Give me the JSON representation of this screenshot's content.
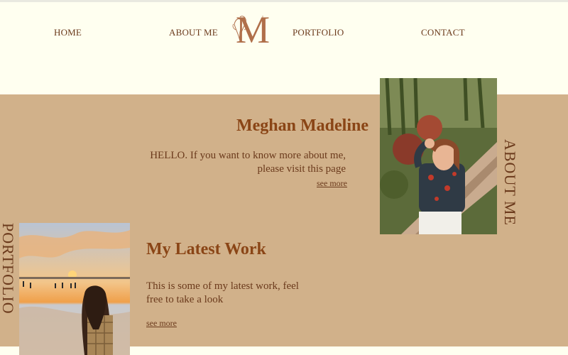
{
  "nav": {
    "home": "HOME",
    "about": "ABOUT ME",
    "portfolio": "PORTFOLIO",
    "contact": "CONTACT"
  },
  "logo": {
    "letter": "M"
  },
  "intro": {
    "name": "Meghan Madeline",
    "hello": "HELLO. If you want to know more about me, please visit this page",
    "see_more": "see more",
    "side_label": "ABOUT ME"
  },
  "work": {
    "side_label": "PORTFOLIO",
    "title": "My Latest Work",
    "text": "This is some of my latest work, feel free to take a look",
    "see_more": "see more"
  },
  "colors": {
    "background": "#fffff0",
    "band": "#d1b18a",
    "heading": "#8a4516",
    "text": "#6b3a1c"
  }
}
